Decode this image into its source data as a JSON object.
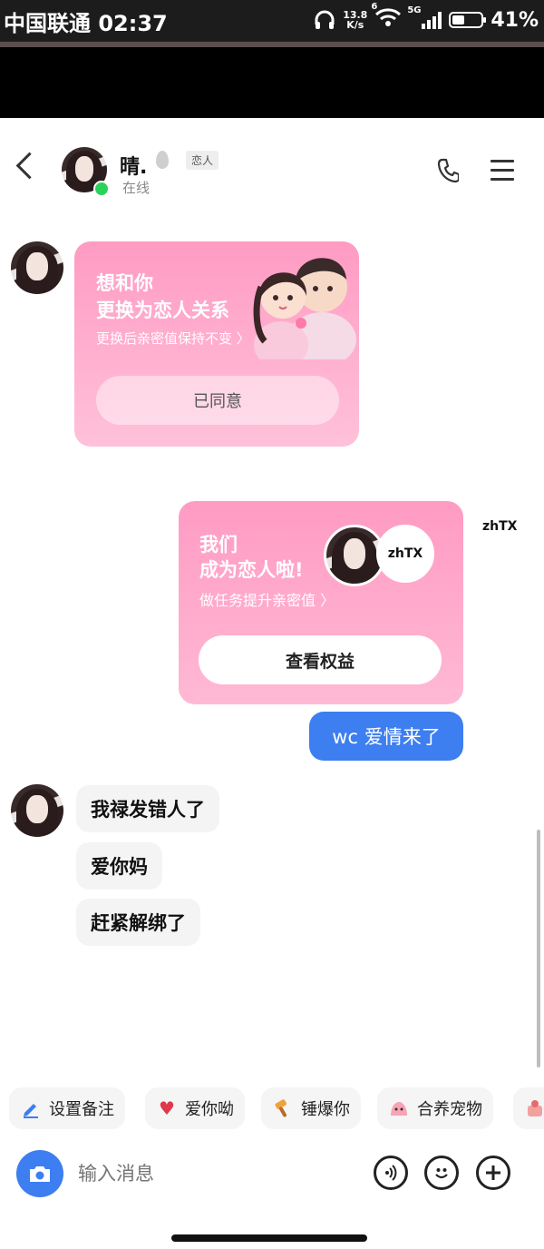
{
  "status_bar": {
    "carrier_time": "中国联通 02:37",
    "net_speed_value": "13.8",
    "net_speed_unit": "K/s",
    "wifi_label": "6",
    "signal_label": "5G",
    "battery": "41%",
    "battery_level": 0.41
  },
  "header": {
    "name": "晴.",
    "tag": "恋人",
    "status": "在线"
  },
  "messages": {
    "invite_card": {
      "line1": "想和你",
      "line2": "更换为恋人关系",
      "line3": "更换后亲密值保持不变 〉",
      "button": "已同意"
    },
    "lovers_card": {
      "line1": "我们",
      "line2": "成为恋人啦!",
      "line3": "做任务提升亲密值 〉",
      "partner_label": "zhTX",
      "button": "查看权益"
    },
    "sender_name": "zhTX",
    "outgoing_text": "wc 爱情来了",
    "incoming": [
      "我禄发错人了",
      "爱你妈",
      "赶紧解绑了"
    ]
  },
  "quick_actions": [
    {
      "label": "设置备注",
      "icon": "pencil-icon"
    },
    {
      "label": "爱你呦",
      "icon": "heart-face-icon"
    },
    {
      "label": "锤爆你",
      "icon": "hammer-icon"
    },
    {
      "label": "合养宠物",
      "icon": "pet-icon"
    }
  ],
  "input": {
    "placeholder": "输入消息"
  },
  "colors": {
    "accent_blue": "#3d7ef0",
    "card_pink": "#ff9bc3",
    "online_green": "#2bd25a"
  }
}
